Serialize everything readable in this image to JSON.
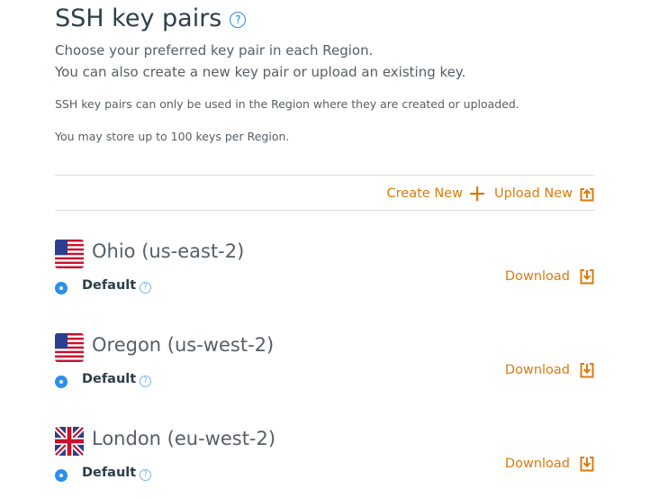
{
  "header": {
    "title": "SSH key pairs",
    "help_glyph": "?",
    "intro_line1": "Choose your preferred key pair in each Region.",
    "intro_line2": "You can also create a new key pair or upload an existing key.",
    "note1": "SSH key pairs can only be used in the Region where they are created or uploaded.",
    "note2": "You may store up to 100 keys per Region."
  },
  "actions": {
    "create_new": "Create New",
    "create_icon": "plus-icon",
    "upload_new": "Upload New",
    "upload_icon": "upload-icon"
  },
  "colors": {
    "accent_orange": "#dd7a0c",
    "radio_blue": "#2c8eed",
    "help_blue": "#1f8fe0"
  },
  "regions": [
    {
      "name": "Ohio (us-east-2)",
      "flag": "us-flag-icon",
      "key_label": "Default",
      "selected": true,
      "help_glyph": "?",
      "download_label": "Download",
      "download_icon": "download-icon"
    },
    {
      "name": "Oregon (us-west-2)",
      "flag": "us-flag-icon",
      "key_label": "Default",
      "selected": true,
      "help_glyph": "?",
      "download_label": "Download",
      "download_icon": "download-icon"
    },
    {
      "name": "London (eu-west-2)",
      "flag": "uk-flag-icon",
      "key_label": "Default",
      "selected": true,
      "help_glyph": "?",
      "download_label": "Download",
      "download_icon": "download-icon"
    }
  ]
}
